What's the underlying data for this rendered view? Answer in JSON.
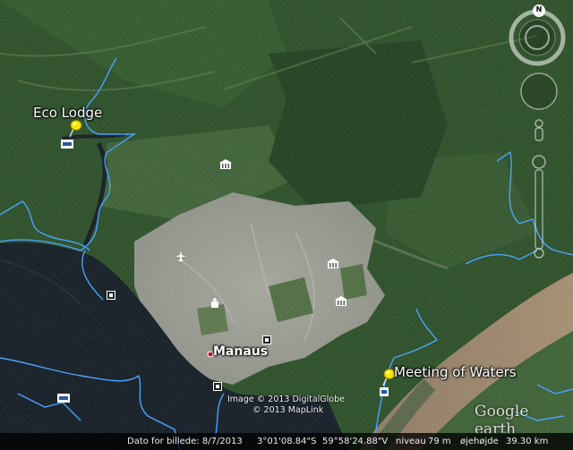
{
  "map": {
    "placemarks": [
      {
        "name": "eco-lodge",
        "label": "Eco Lodge"
      },
      {
        "name": "meeting-of-waters",
        "label": "Meeting of Waters"
      }
    ],
    "city_label": "Manaus",
    "copyright": [
      "Image © 2013 DigitalGlobe",
      "© 2013 MapLink"
    ],
    "logo": "Google earth",
    "colors": {
      "forest": "#254a22",
      "urban": "#9a9c92",
      "river_dark": "#0d151e",
      "river_muddy": "#a08a6c",
      "border": "#4aa3ff"
    }
  },
  "navigation": {
    "north_label": "N",
    "controls": [
      "compass-ring",
      "look-joystick",
      "move-joystick",
      "street-view-pegman",
      "zoom-slider"
    ]
  },
  "status_bar": {
    "image_date": "Dato for billede: 8/7/2013",
    "latitude": "3°01'08.84\"S",
    "longitude": "59°58'24.88\"V",
    "level_label": "niveau",
    "level_value": "79 m",
    "eye_alt_label": "øjehøjde",
    "eye_alt_value": "39.30 km"
  }
}
